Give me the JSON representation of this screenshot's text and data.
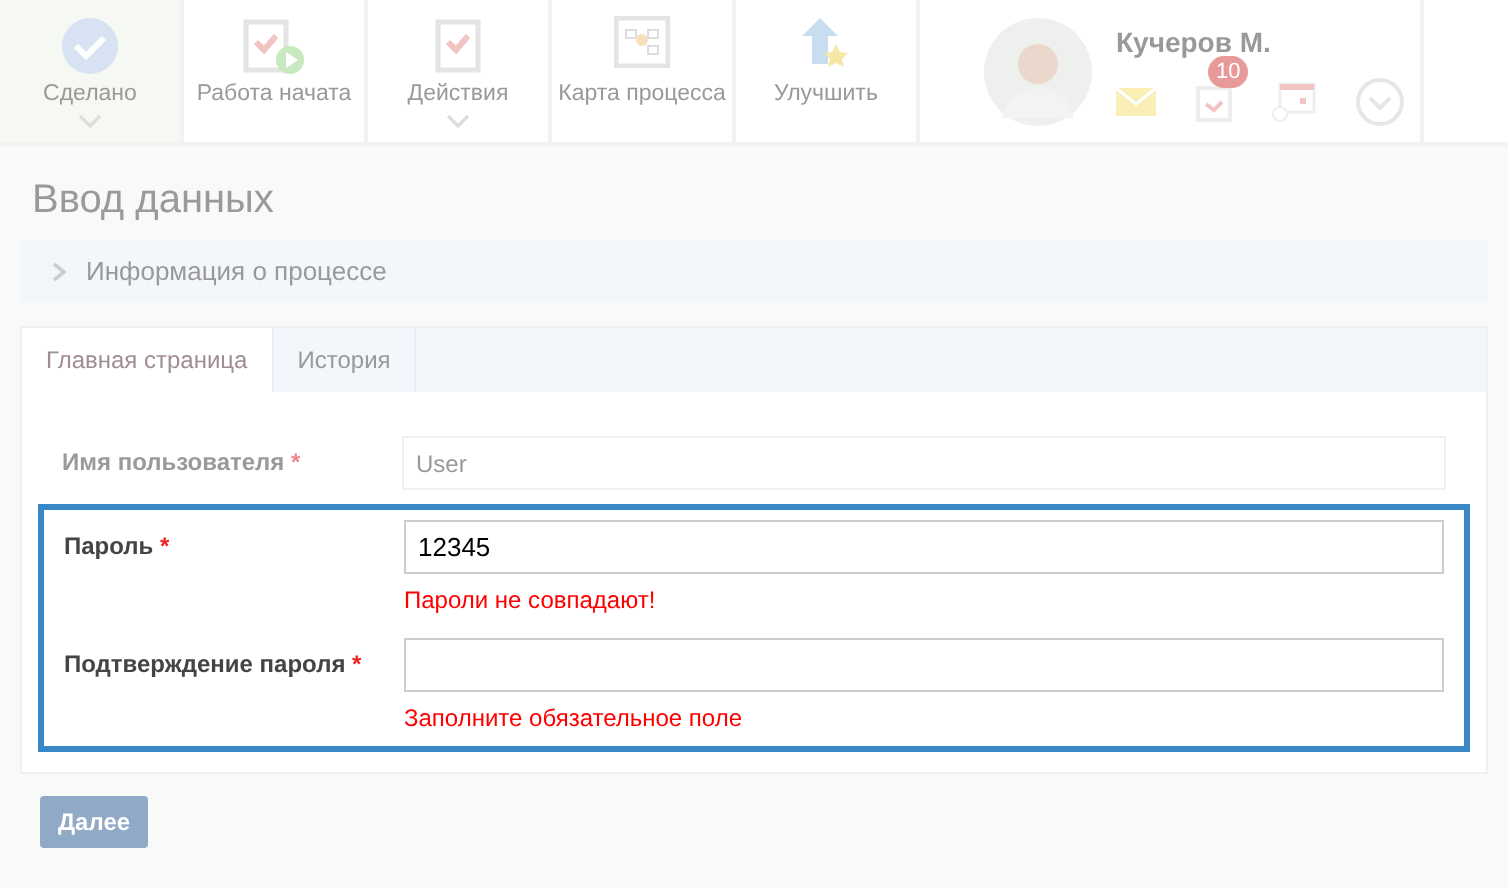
{
  "toolbar": {
    "buttons": [
      {
        "label": "Сделано",
        "kind": "done",
        "dropdown": true,
        "selected": true
      },
      {
        "label": "Работа начата",
        "kind": "started",
        "dropdown": false,
        "selected": false
      },
      {
        "label": "Действия",
        "kind": "actions",
        "dropdown": true,
        "selected": false
      },
      {
        "label": "Карта процесса",
        "kind": "map",
        "dropdown": false,
        "selected": false
      },
      {
        "label": "Улучшить",
        "kind": "improve",
        "dropdown": false,
        "selected": false
      }
    ]
  },
  "profile": {
    "name": "Кучеров М.",
    "tasks_badge": "10"
  },
  "page_title": "Ввод данных",
  "info_bar": {
    "label": "Информация о процессе",
    "expanded": false
  },
  "tabs": [
    {
      "label": "Главная страница",
      "selected": true
    },
    {
      "label": "История",
      "selected": false
    }
  ],
  "fields": [
    {
      "label": "Имя пользователя",
      "required_mark": "*",
      "value": "User",
      "highlighted": false
    },
    {
      "label": "Пароль",
      "required_mark": "*",
      "value": "12345",
      "error": "Пароли не совпадают!",
      "highlighted": true
    },
    {
      "label": "Подтверждение пароля",
      "required_mark": "*",
      "error": "Заполните обязательное поле",
      "highlighted": true
    }
  ],
  "submit": {
    "label": "Далее"
  }
}
